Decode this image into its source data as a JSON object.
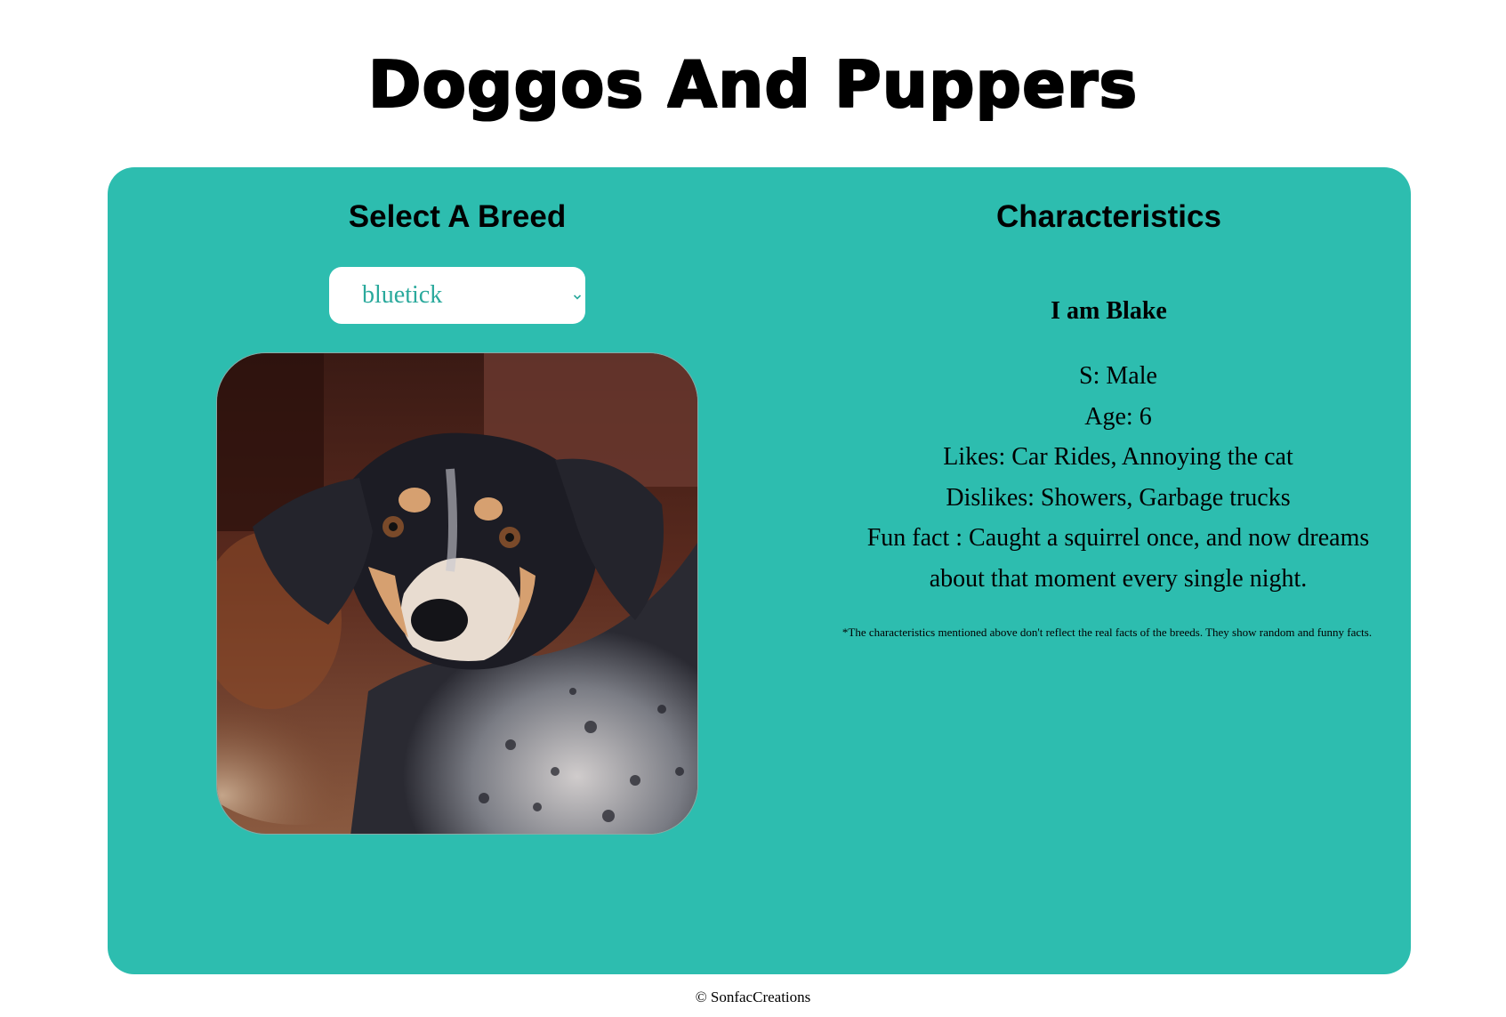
{
  "site_title": "Doggos And Puppers",
  "colors": {
    "panel_background": "#2dbdaf",
    "select_text": "#2aa99c",
    "page_background": "#ffffff"
  },
  "select_panel": {
    "heading": "Select A Breed",
    "breed_select": {
      "selected_value": "bluetick",
      "icon": "chevron-down-icon"
    },
    "photo_alt": "bluetick dog photo"
  },
  "characteristics_panel": {
    "heading": "Characteristics",
    "name_line": "I am Blake",
    "sex": "S: Male",
    "age": "Age: 6",
    "likes": "Likes: Car Rides, Annoying the cat",
    "dislikes": "Dislikes: Showers, Garbage trucks",
    "fun_fact": "Fun fact : Caught a squirrel once, and now dreams about that moment every single night.",
    "disclaimer": "*The characteristics mentioned above don't reflect the real facts of the breeds. They show random and funny facts."
  },
  "footer": {
    "copyright": "© SonfacCreations"
  }
}
